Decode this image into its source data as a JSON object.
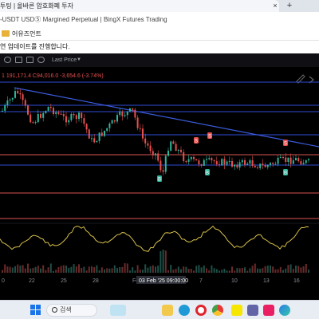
{
  "browser": {
    "tab_title": "투팅 | 올바른 암호화폐 투자 × | BTC-USDT USDⓈ Margined Perpetual | BingX Futures Trading",
    "tab_text": "투팅 | 올바른 암호화폐 투자",
    "tab_close": "×",
    "new_tab": "+",
    "bookmark_label": "어유즈언트",
    "notice_text": "연  업데이트를 진행합니다.",
    "page_heading": "-USDT USDⓈ Margined Perpetual | BingX Futures Trading"
  },
  "chart_toolbar": {
    "price_mode": "Last Price",
    "icons": [
      "crosshair-icon",
      "candle-type-icon",
      "camera-icon",
      "settings-icon"
    ]
  },
  "chart": {
    "ohlc_readout": "1  191,171.4  C94,016.0  -3,654.6 (-3.74%)",
    "x_ticks": [
      "0",
      "22",
      "25",
      "28",
      "Fe",
      "7",
      "10",
      "13",
      "16"
    ],
    "crosshair_label": "03 Feb '25  09:00:00",
    "markers_buy": "B",
    "markers_sell": "S",
    "colors": {
      "up": "#2fb59c",
      "down": "#e8504f",
      "trendline": "#3b5bdb",
      "oscillator": "#d8c24a",
      "hline_red": "#d9534f",
      "hline_blue": "#2f4bd6"
    }
  },
  "taskbar": {
    "search_label": "검색",
    "apps": [
      "start-icon",
      "search-icon",
      "cloud-app-icon",
      "file-explorer-icon",
      "edge-icon",
      "opera-icon",
      "chrome-icon",
      "kakaotalk-icon",
      "teams-icon",
      "store-icon",
      "copilot-icon"
    ]
  }
}
